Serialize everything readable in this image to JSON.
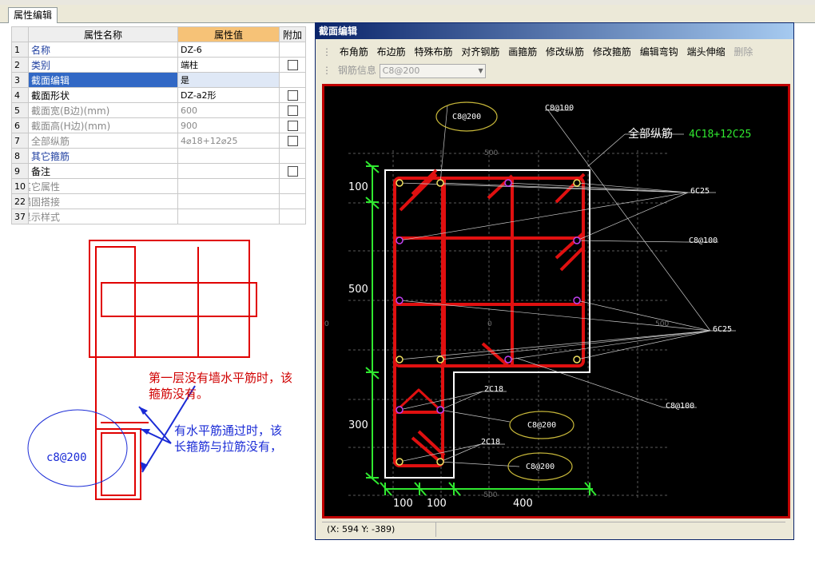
{
  "tab": {
    "label": "属性编辑"
  },
  "grid": {
    "headers": {
      "name": "属性名称",
      "value": "属性值",
      "extra": "附加"
    },
    "rows": [
      {
        "num": "1",
        "name": "名称",
        "value": "DZ-6",
        "check": false
      },
      {
        "num": "2",
        "name": "类别",
        "value": "端柱",
        "check": true
      },
      {
        "num": "3",
        "name": "截面编辑",
        "value": "是",
        "check": false
      },
      {
        "num": "4",
        "name": "截面形状",
        "value": "DZ-a2形",
        "check": true
      },
      {
        "num": "5",
        "name": "截面宽(B边)(mm)",
        "value": "600",
        "check": true
      },
      {
        "num": "6",
        "name": "截面高(H边)(mm)",
        "value": "900",
        "check": true
      },
      {
        "num": "7",
        "name": "全部纵筋",
        "value": "4⌀18+12⌀25",
        "check": true
      },
      {
        "num": "8",
        "name": "其它箍筋",
        "value": "",
        "check": false
      },
      {
        "num": "9",
        "name": "备注",
        "value": "",
        "check": true
      },
      {
        "num": "10",
        "name": "其它属性",
        "value": "",
        "check": false
      },
      {
        "num": "22",
        "name": "锚固搭接",
        "value": "",
        "check": false
      },
      {
        "num": "37",
        "name": "显示样式",
        "value": "",
        "check": false
      }
    ]
  },
  "sketch": {
    "note1": "第一层没有墙水平筋时，该",
    "note1b": "箍筋没有。",
    "note2": "有水平筋通过时，该",
    "note2b": "长箍筋与拉筋没有，",
    "circle_label": "c8@200"
  },
  "dialog": {
    "title": "截面编辑",
    "toolbar": [
      "布角筋",
      "布边筋",
      "特殊布筋",
      "对齐钢筋",
      "画箍筋",
      "修改纵筋",
      "修改箍筋",
      "编辑弯钩",
      "端头伸缩",
      "删除"
    ],
    "rebar_info_label": "钢筋信息",
    "rebar_info_value": "C8@200",
    "status": "(X: 594 Y: -389)"
  },
  "drawing": {
    "all_rebar_label": "全部纵筋",
    "all_rebar_value": "4C18+12C25",
    "labels": {
      "c8200_top": "C8@200",
      "c8100_top": "C8@100",
      "c25_top": "6C25",
      "c8100_mid": "C8@100",
      "c25_mid": "6C25",
      "c8100_low": "C8@100",
      "c18_a": "2C18",
      "c18_b": "2C18",
      "c8200_low1": "C8@200",
      "c8200_low2": "C8@200"
    },
    "dims": {
      "v100": "100",
      "v500": "500",
      "v300": "300",
      "h100a": "100",
      "h100b": "100",
      "h400": "400"
    },
    "grid_labels": {
      "g500top": "500",
      "g500r": "500",
      "g0": "0",
      "gneg500": "-500",
      "g0l": "0"
    }
  }
}
